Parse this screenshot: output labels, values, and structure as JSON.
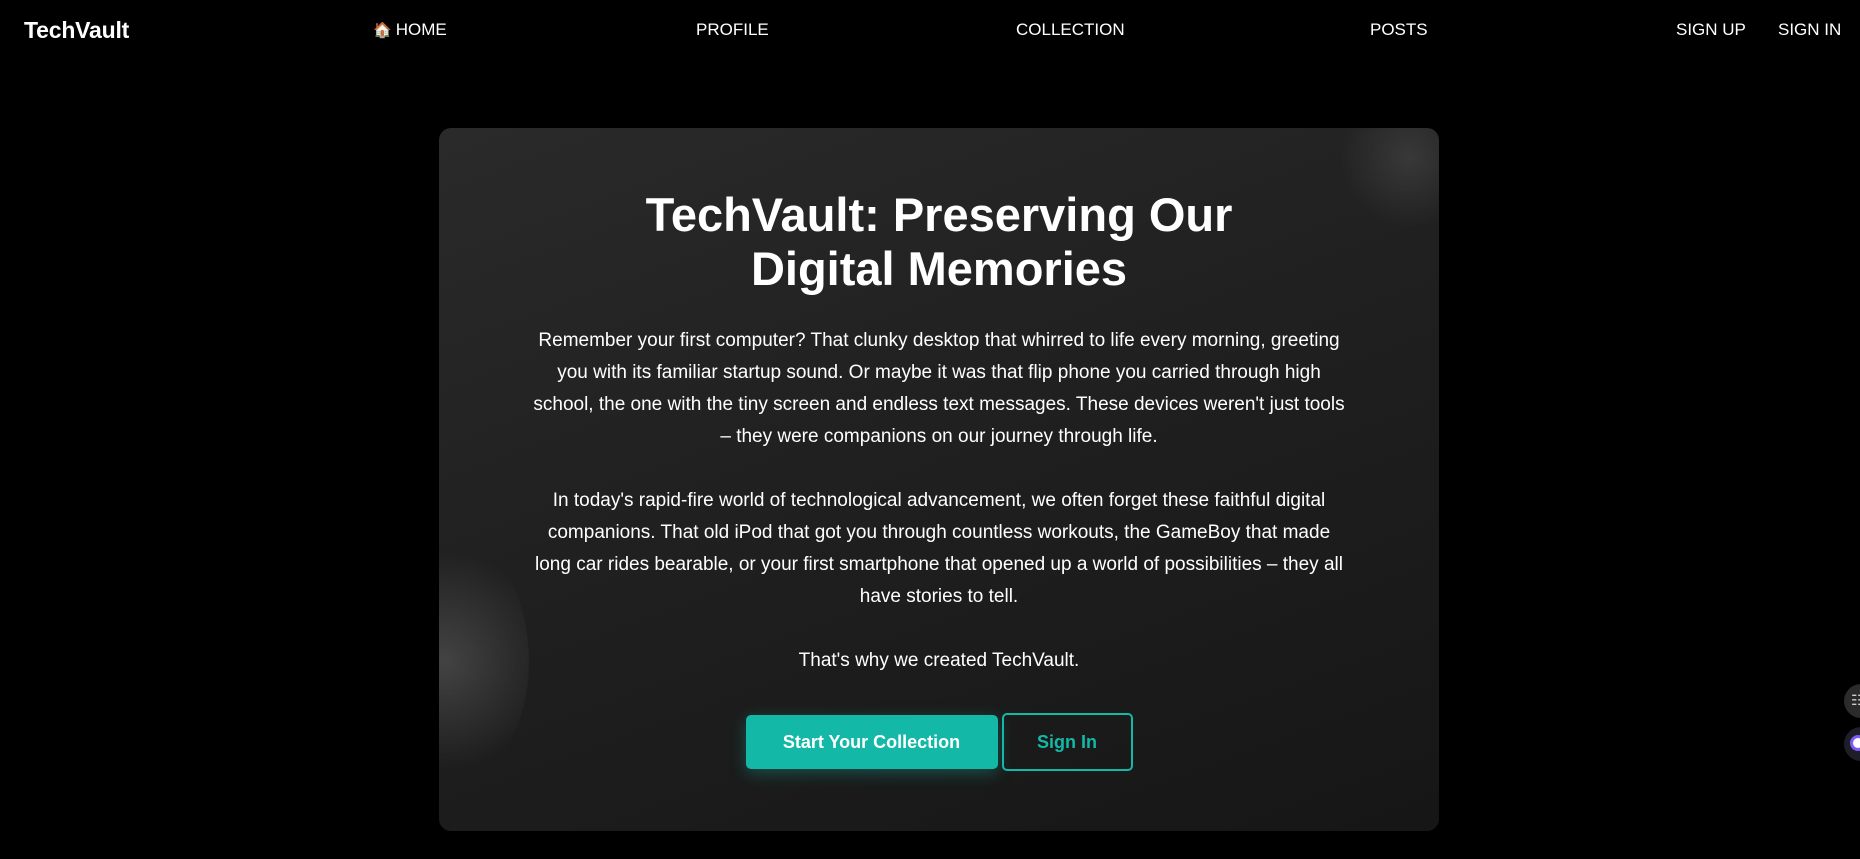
{
  "nav": {
    "brand": "TechVault",
    "home": {
      "icon": "home-icon",
      "glyph": "🏠",
      "label": "HOME"
    },
    "profile": "PROFILE",
    "collection": "COLLECTION",
    "posts": "POSTS",
    "sign_up": "SIGN UP",
    "sign_in": "SIGN IN"
  },
  "hero": {
    "title": "TechVault: Preserving Our Digital Memories",
    "paragraphs": [
      "Remember your first computer? That clunky desktop that whirred to life every morning, greeting you with its familiar startup sound. Or maybe it was that flip phone you carried through high school, the one with the tiny screen and endless text messages. These devices weren't just tools – they were companions on our journey through life.",
      "In today's rapid-fire world of technological advancement, we often forget these faithful digital companions. That old iPod that got you through countless workouts, the GameBoy that made long car rides bearable, or your first smartphone that opened up a world of possibilities – they all have stories to tell.",
      "That's why we created TechVault."
    ],
    "primary_button": "Start Your Collection",
    "secondary_button": "Sign In"
  },
  "colors": {
    "accent": "#14b8a6",
    "background": "#000000",
    "card": "#222222"
  },
  "floating_widgets": [
    {
      "icon": "widget-icon"
    },
    {
      "icon": "assistant-icon"
    }
  ]
}
